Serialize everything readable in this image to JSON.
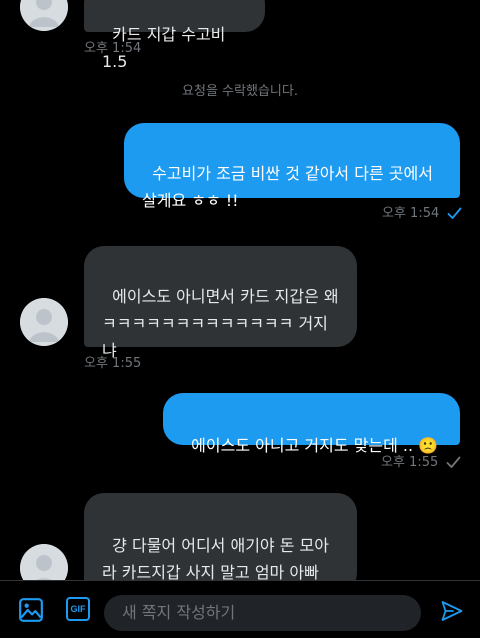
{
  "messages": {
    "m1": {
      "text": "카드 지갑 수고비 1.5",
      "time": "오후 1:54"
    },
    "notice": "요청을 수락했습니다.",
    "m2": {
      "text": "수고비가 조금 비싼 것 같아서 다른 곳에서\n살게요 ㅎㅎ !!",
      "time": "오후 1:54"
    },
    "m3": {
      "text": "에이스도 아니면서 카드 지갑은 왜\nㅋㅋㅋㅋㅋㅋㅋㅋㅋㅋㅋㅋㅋ 거지\n냐",
      "time": "오후 1:55"
    },
    "m4": {
      "text": "에이스도 아니고 거지도 맞는데 .. 🙁",
      "time": "오후 1:55"
    },
    "m5": {
      "text": "걍 다물어 어디서 애기야 돈 모아\n라 카드지갑 사지 말고 엄마 아빠\n가 슬퍼하신다^^"
    }
  },
  "composer": {
    "placeholder": "새 쪽지 작성하기",
    "gif_label": "GIF"
  },
  "colors": {
    "accent": "#1d9bf0",
    "incoming_bubble": "#2f3336",
    "secondary_text": "#71767b"
  },
  "icons": [
    "avatar-icon",
    "checkmark-icon",
    "image-icon",
    "gif-icon",
    "send-icon"
  ]
}
